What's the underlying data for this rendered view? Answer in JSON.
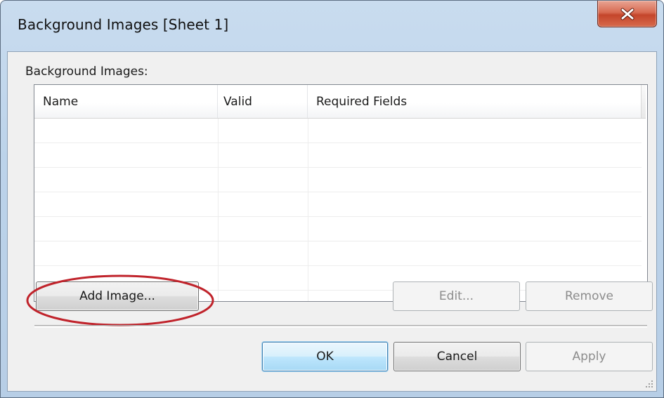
{
  "window": {
    "title": "Background Images [Sheet 1]",
    "close_icon": "close-icon"
  },
  "dialog": {
    "section_label": "Background Images:",
    "table": {
      "columns": [
        "Name",
        "Valid",
        "Required Fields"
      ],
      "rows": []
    },
    "buttons": {
      "add_image": "Add Image...",
      "edit": "Edit...",
      "remove": "Remove",
      "ok": "OK",
      "cancel": "Cancel",
      "apply": "Apply"
    }
  },
  "colors": {
    "highlight_ellipse": "#c0232b",
    "close_button": "#c4452b",
    "default_button_border": "#3c7fb1"
  }
}
